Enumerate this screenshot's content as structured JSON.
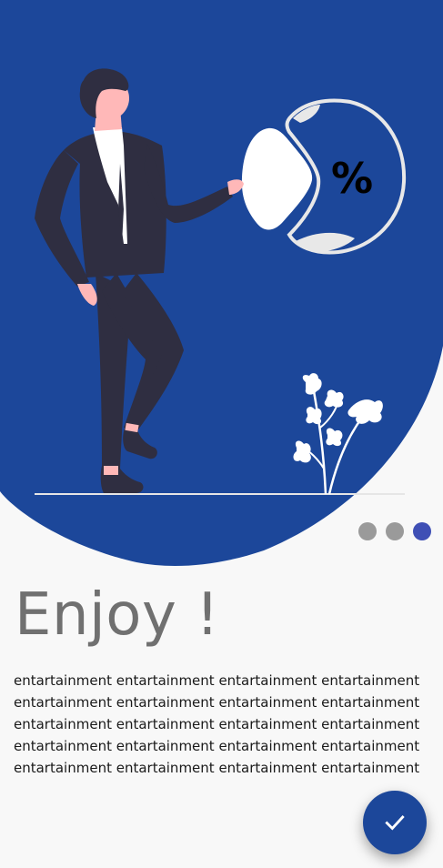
{
  "hero": {
    "illustration_icon": "man-with-percent-chart-illustration",
    "badge_text": "%",
    "background_color": "#1c479a"
  },
  "pager": {
    "total": 3,
    "current": 3,
    "active_color": "#3f4fb5",
    "inactive_color": "#9a9a9a"
  },
  "content": {
    "title": "Enjoy !",
    "body": "entartainment entartainment entartainment entartainment entartainment entartainment entartainment entartainment entartainment entartainment entartainment entartainment entartainment entartainment entartainment entartainment entartainment entartainment entartainment entartainment"
  },
  "fab": {
    "icon": "check-icon",
    "color": "#1c479a"
  }
}
